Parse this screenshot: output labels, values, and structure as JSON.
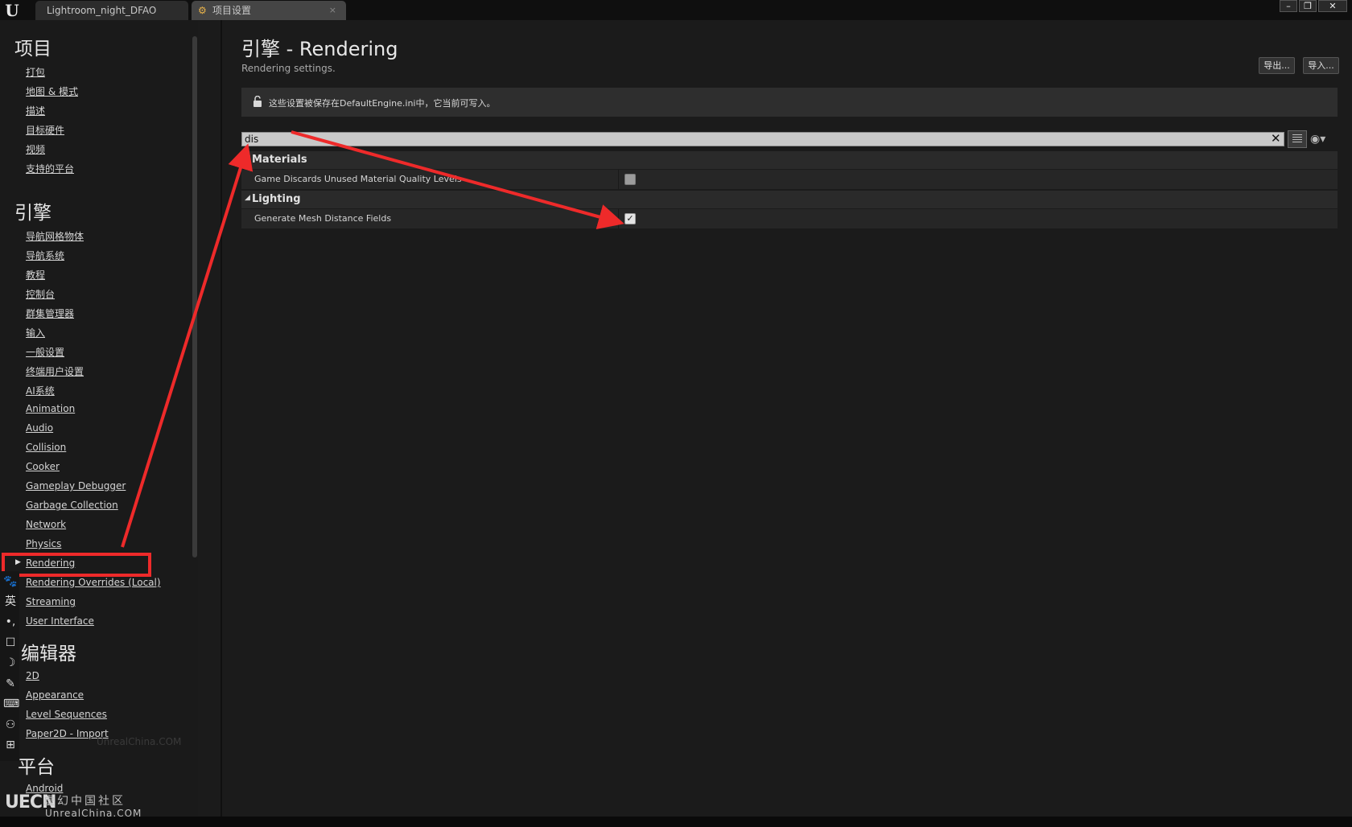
{
  "titlebar": {
    "tabs": [
      {
        "label": "Lightroom_night_DFAO"
      },
      {
        "label": "项目设置"
      }
    ],
    "tab_close_glyph": "×",
    "window_controls": {
      "minimize": "–",
      "maximize": "❐",
      "close": "✕"
    }
  },
  "sidebar": {
    "sections": [
      {
        "title": "项目",
        "items": [
          "打包",
          "地图 & 模式",
          "描述",
          "目标硬件",
          "视频",
          "支持的平台"
        ]
      },
      {
        "title": "引擎",
        "items": [
          "导航网格物体",
          "导航系统",
          "教程",
          "控制台",
          "群集管理器",
          "输入",
          "一般设置",
          "终端用户设置",
          "AI系统",
          "Animation",
          "Audio",
          "Collision",
          "Cooker",
          "Gameplay Debugger",
          "Garbage Collection",
          "Network",
          "Physics",
          "Rendering",
          "Rendering Overrides (Local)",
          "Streaming",
          "User Interface"
        ]
      },
      {
        "title": "编辑器",
        "items": [
          "2D",
          "Appearance",
          "Level Sequences",
          "Paper2D - Import"
        ]
      },
      {
        "title": "平台",
        "items": [
          "Android"
        ]
      }
    ],
    "selected_item": "Rendering",
    "highlight_color": "#ee2a2a"
  },
  "ime_toolbar": {
    "icons": [
      "paw-icon",
      "language-icon",
      "punctuation-icon",
      "keyboard-layout-icon",
      "moon-icon",
      "pen-icon",
      "keyboard-icon",
      "user-icon",
      "grid-icon"
    ],
    "language_glyph": "英"
  },
  "watermark": {
    "logo": "UECN",
    "cn": "虚幻中国社区",
    "en": "UnrealChina.COM"
  },
  "main": {
    "title": "引擎 - Rendering",
    "subtitle": "Rendering settings.",
    "export_label": "导出...",
    "import_label": "导入...",
    "info_text": "这些设置被保存在DefaultEngine.ini中，它当前可写入。",
    "search": {
      "value": "dis",
      "clear_glyph": "✕"
    },
    "categories": [
      {
        "label": "Materials",
        "properties": [
          {
            "label": "Game Discards Unused Material Quality Levels",
            "checked": false
          }
        ]
      },
      {
        "label": "Lighting",
        "properties": [
          {
            "label": "Generate Mesh Distance Fields",
            "checked": true
          }
        ]
      }
    ]
  },
  "annotation_color": "#ee2a2a"
}
